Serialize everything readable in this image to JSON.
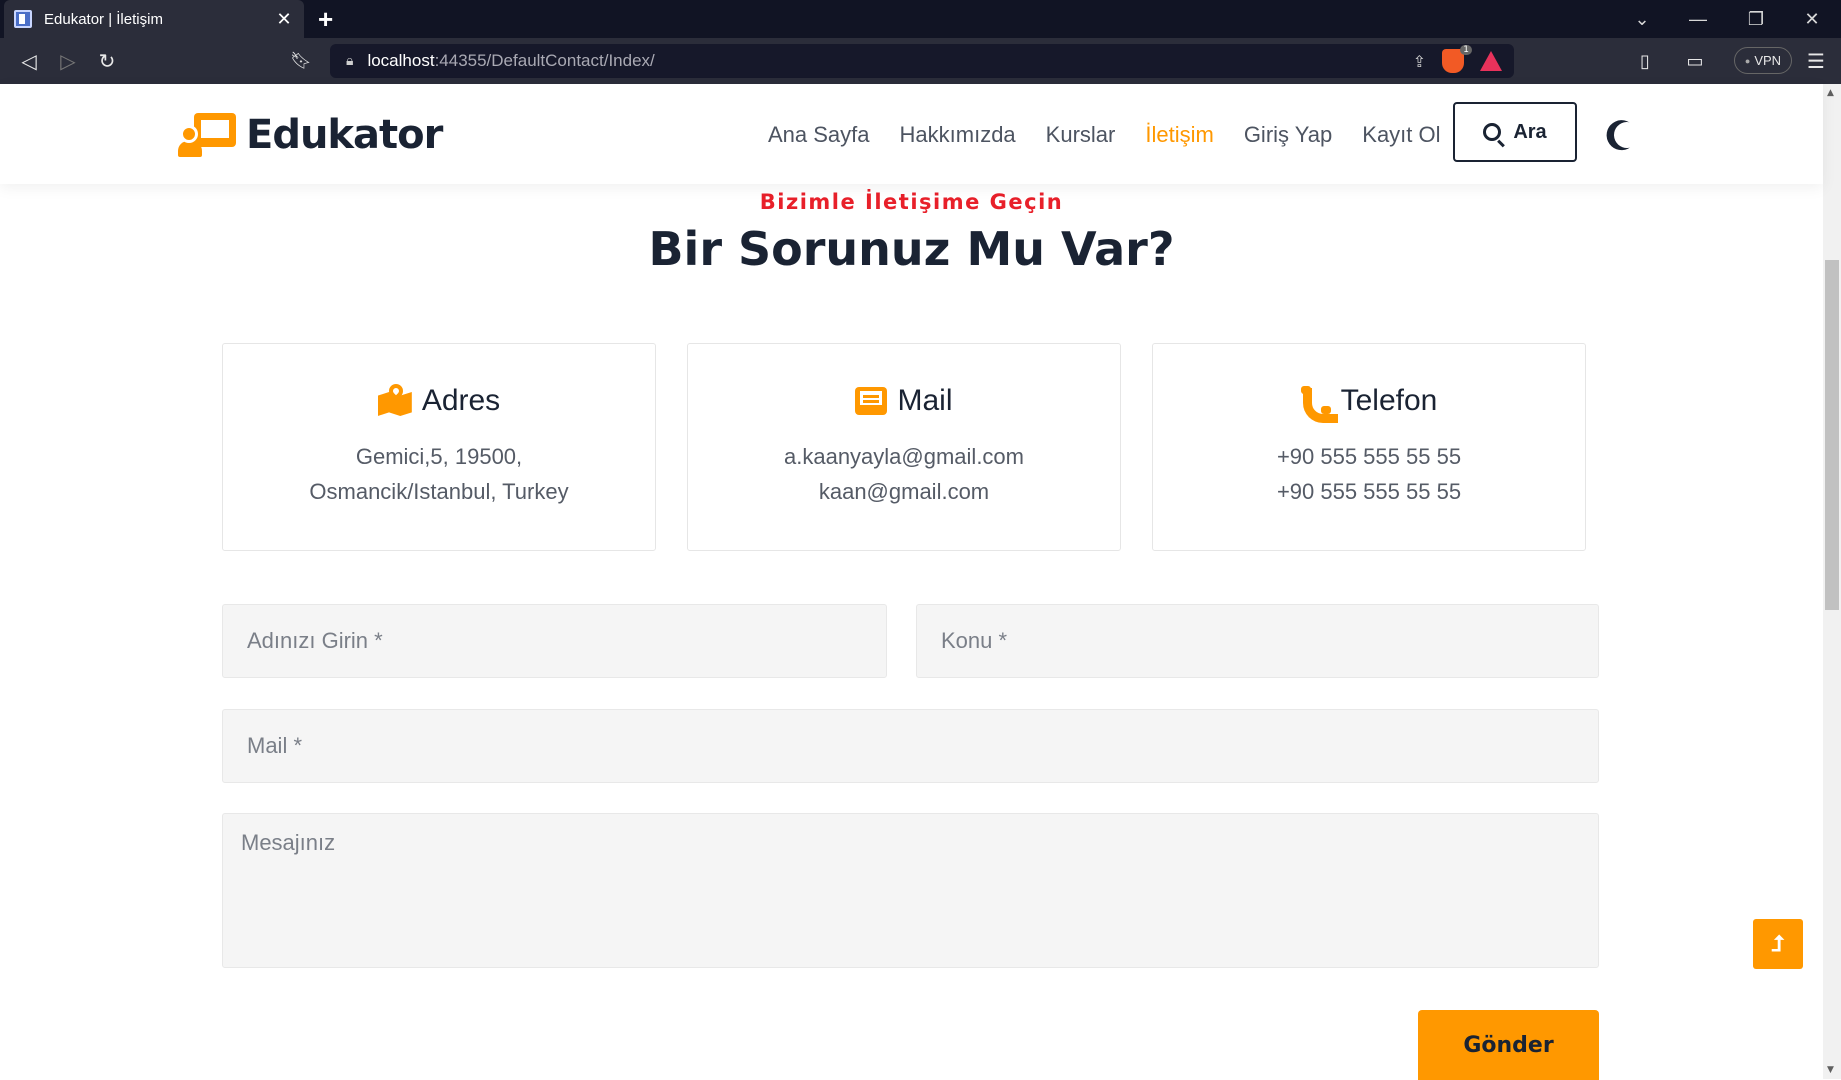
{
  "browser": {
    "tab_title": "Edukator | İletişim",
    "url_host": "localhost",
    "url_rest": ":44355/DefaultContact/Index/",
    "brave_badge": "1",
    "vpn_label": "VPN"
  },
  "site": {
    "brand": "Edukator",
    "nav": [
      "Ana Sayfa",
      "Hakkımızda",
      "Kurslar",
      "İletişim",
      "Giriş Yap",
      "Kayıt Ol"
    ],
    "active_nav": "İletişim",
    "search_label": "Ara"
  },
  "section": {
    "eyebrow": "Bizimle İletişime Geçin",
    "heading_part1": "Bir",
    "heading_part2": " Sorunuz ",
    "heading_part3": "Mu Var?"
  },
  "cards": [
    {
      "title": "Adres",
      "icon": "map-icon",
      "lines": [
        "Gemici,5, 19500,",
        "Osmancik/Istanbul, Turkey"
      ]
    },
    {
      "title": "Mail",
      "icon": "envelope-icon",
      "lines": [
        "a.kaanyayla@gmail.com",
        "kaan@gmail.com"
      ]
    },
    {
      "title": "Telefon",
      "icon": "phone-icon",
      "lines": [
        "+90 555 555 55 55",
        "+90 555 555 55 55"
      ]
    }
  ],
  "form": {
    "name_placeholder": "Adınızı Girin *",
    "subject_placeholder": "Konu *",
    "mail_placeholder": "Mail *",
    "message_placeholder": "Mesajınız",
    "submit_label": "Gönder"
  },
  "colors": {
    "accent": "#ff9800",
    "eyebrow": "#e8202a",
    "dark": "#1a2333"
  }
}
